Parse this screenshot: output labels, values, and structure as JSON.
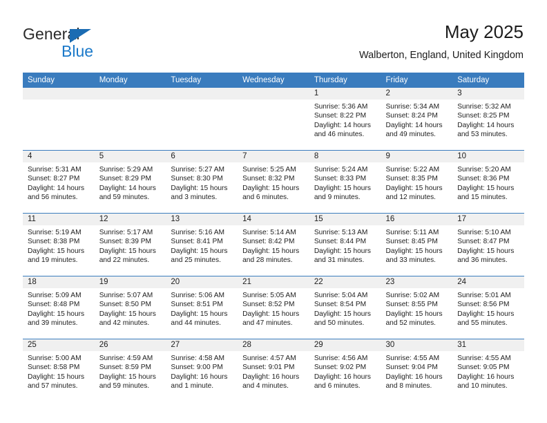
{
  "brand": {
    "name_top": "General",
    "name_bottom": "Blue",
    "triangle_color": "#1b6cb3",
    "blue_text_color": "#1b79c9"
  },
  "header": {
    "title": "May 2025",
    "subtitle": "Walberton, England, United Kingdom"
  },
  "theme": {
    "header_blue": "#3a7cbe",
    "daynum_band": "#f0f0f0",
    "row_divider": "#3a7cbe",
    "text": "#1d1d1d"
  },
  "weekday_headers": [
    "Sunday",
    "Monday",
    "Tuesday",
    "Wednesday",
    "Thursday",
    "Friday",
    "Saturday"
  ],
  "weeks": [
    [
      {
        "empty": true,
        "day": "",
        "sunrise": "",
        "sunset": "",
        "daylight_line1": "",
        "daylight_line2": ""
      },
      {
        "empty": true,
        "day": "",
        "sunrise": "",
        "sunset": "",
        "daylight_line1": "",
        "daylight_line2": ""
      },
      {
        "empty": true,
        "day": "",
        "sunrise": "",
        "sunset": "",
        "daylight_line1": "",
        "daylight_line2": ""
      },
      {
        "empty": true,
        "day": "",
        "sunrise": "",
        "sunset": "",
        "daylight_line1": "",
        "daylight_line2": ""
      },
      {
        "empty": false,
        "day": "1",
        "sunrise": "Sunrise: 5:36 AM",
        "sunset": "Sunset: 8:22 PM",
        "daylight_line1": "Daylight: 14 hours",
        "daylight_line2": "and 46 minutes."
      },
      {
        "empty": false,
        "day": "2",
        "sunrise": "Sunrise: 5:34 AM",
        "sunset": "Sunset: 8:24 PM",
        "daylight_line1": "Daylight: 14 hours",
        "daylight_line2": "and 49 minutes."
      },
      {
        "empty": false,
        "day": "3",
        "sunrise": "Sunrise: 5:32 AM",
        "sunset": "Sunset: 8:25 PM",
        "daylight_line1": "Daylight: 14 hours",
        "daylight_line2": "and 53 minutes."
      }
    ],
    [
      {
        "empty": false,
        "day": "4",
        "sunrise": "Sunrise: 5:31 AM",
        "sunset": "Sunset: 8:27 PM",
        "daylight_line1": "Daylight: 14 hours",
        "daylight_line2": "and 56 minutes."
      },
      {
        "empty": false,
        "day": "5",
        "sunrise": "Sunrise: 5:29 AM",
        "sunset": "Sunset: 8:29 PM",
        "daylight_line1": "Daylight: 14 hours",
        "daylight_line2": "and 59 minutes."
      },
      {
        "empty": false,
        "day": "6",
        "sunrise": "Sunrise: 5:27 AM",
        "sunset": "Sunset: 8:30 PM",
        "daylight_line1": "Daylight: 15 hours",
        "daylight_line2": "and 3 minutes."
      },
      {
        "empty": false,
        "day": "7",
        "sunrise": "Sunrise: 5:25 AM",
        "sunset": "Sunset: 8:32 PM",
        "daylight_line1": "Daylight: 15 hours",
        "daylight_line2": "and 6 minutes."
      },
      {
        "empty": false,
        "day": "8",
        "sunrise": "Sunrise: 5:24 AM",
        "sunset": "Sunset: 8:33 PM",
        "daylight_line1": "Daylight: 15 hours",
        "daylight_line2": "and 9 minutes."
      },
      {
        "empty": false,
        "day": "9",
        "sunrise": "Sunrise: 5:22 AM",
        "sunset": "Sunset: 8:35 PM",
        "daylight_line1": "Daylight: 15 hours",
        "daylight_line2": "and 12 minutes."
      },
      {
        "empty": false,
        "day": "10",
        "sunrise": "Sunrise: 5:20 AM",
        "sunset": "Sunset: 8:36 PM",
        "daylight_line1": "Daylight: 15 hours",
        "daylight_line2": "and 15 minutes."
      }
    ],
    [
      {
        "empty": false,
        "day": "11",
        "sunrise": "Sunrise: 5:19 AM",
        "sunset": "Sunset: 8:38 PM",
        "daylight_line1": "Daylight: 15 hours",
        "daylight_line2": "and 19 minutes."
      },
      {
        "empty": false,
        "day": "12",
        "sunrise": "Sunrise: 5:17 AM",
        "sunset": "Sunset: 8:39 PM",
        "daylight_line1": "Daylight: 15 hours",
        "daylight_line2": "and 22 minutes."
      },
      {
        "empty": false,
        "day": "13",
        "sunrise": "Sunrise: 5:16 AM",
        "sunset": "Sunset: 8:41 PM",
        "daylight_line1": "Daylight: 15 hours",
        "daylight_line2": "and 25 minutes."
      },
      {
        "empty": false,
        "day": "14",
        "sunrise": "Sunrise: 5:14 AM",
        "sunset": "Sunset: 8:42 PM",
        "daylight_line1": "Daylight: 15 hours",
        "daylight_line2": "and 28 minutes."
      },
      {
        "empty": false,
        "day": "15",
        "sunrise": "Sunrise: 5:13 AM",
        "sunset": "Sunset: 8:44 PM",
        "daylight_line1": "Daylight: 15 hours",
        "daylight_line2": "and 31 minutes."
      },
      {
        "empty": false,
        "day": "16",
        "sunrise": "Sunrise: 5:11 AM",
        "sunset": "Sunset: 8:45 PM",
        "daylight_line1": "Daylight: 15 hours",
        "daylight_line2": "and 33 minutes."
      },
      {
        "empty": false,
        "day": "17",
        "sunrise": "Sunrise: 5:10 AM",
        "sunset": "Sunset: 8:47 PM",
        "daylight_line1": "Daylight: 15 hours",
        "daylight_line2": "and 36 minutes."
      }
    ],
    [
      {
        "empty": false,
        "day": "18",
        "sunrise": "Sunrise: 5:09 AM",
        "sunset": "Sunset: 8:48 PM",
        "daylight_line1": "Daylight: 15 hours",
        "daylight_line2": "and 39 minutes."
      },
      {
        "empty": false,
        "day": "19",
        "sunrise": "Sunrise: 5:07 AM",
        "sunset": "Sunset: 8:50 PM",
        "daylight_line1": "Daylight: 15 hours",
        "daylight_line2": "and 42 minutes."
      },
      {
        "empty": false,
        "day": "20",
        "sunrise": "Sunrise: 5:06 AM",
        "sunset": "Sunset: 8:51 PM",
        "daylight_line1": "Daylight: 15 hours",
        "daylight_line2": "and 44 minutes."
      },
      {
        "empty": false,
        "day": "21",
        "sunrise": "Sunrise: 5:05 AM",
        "sunset": "Sunset: 8:52 PM",
        "daylight_line1": "Daylight: 15 hours",
        "daylight_line2": "and 47 minutes."
      },
      {
        "empty": false,
        "day": "22",
        "sunrise": "Sunrise: 5:04 AM",
        "sunset": "Sunset: 8:54 PM",
        "daylight_line1": "Daylight: 15 hours",
        "daylight_line2": "and 50 minutes."
      },
      {
        "empty": false,
        "day": "23",
        "sunrise": "Sunrise: 5:02 AM",
        "sunset": "Sunset: 8:55 PM",
        "daylight_line1": "Daylight: 15 hours",
        "daylight_line2": "and 52 minutes."
      },
      {
        "empty": false,
        "day": "24",
        "sunrise": "Sunrise: 5:01 AM",
        "sunset": "Sunset: 8:56 PM",
        "daylight_line1": "Daylight: 15 hours",
        "daylight_line2": "and 55 minutes."
      }
    ],
    [
      {
        "empty": false,
        "day": "25",
        "sunrise": "Sunrise: 5:00 AM",
        "sunset": "Sunset: 8:58 PM",
        "daylight_line1": "Daylight: 15 hours",
        "daylight_line2": "and 57 minutes."
      },
      {
        "empty": false,
        "day": "26",
        "sunrise": "Sunrise: 4:59 AM",
        "sunset": "Sunset: 8:59 PM",
        "daylight_line1": "Daylight: 15 hours",
        "daylight_line2": "and 59 minutes."
      },
      {
        "empty": false,
        "day": "27",
        "sunrise": "Sunrise: 4:58 AM",
        "sunset": "Sunset: 9:00 PM",
        "daylight_line1": "Daylight: 16 hours",
        "daylight_line2": "and 1 minute."
      },
      {
        "empty": false,
        "day": "28",
        "sunrise": "Sunrise: 4:57 AM",
        "sunset": "Sunset: 9:01 PM",
        "daylight_line1": "Daylight: 16 hours",
        "daylight_line2": "and 4 minutes."
      },
      {
        "empty": false,
        "day": "29",
        "sunrise": "Sunrise: 4:56 AM",
        "sunset": "Sunset: 9:02 PM",
        "daylight_line1": "Daylight: 16 hours",
        "daylight_line2": "and 6 minutes."
      },
      {
        "empty": false,
        "day": "30",
        "sunrise": "Sunrise: 4:55 AM",
        "sunset": "Sunset: 9:04 PM",
        "daylight_line1": "Daylight: 16 hours",
        "daylight_line2": "and 8 minutes."
      },
      {
        "empty": false,
        "day": "31",
        "sunrise": "Sunrise: 4:55 AM",
        "sunset": "Sunset: 9:05 PM",
        "daylight_line1": "Daylight: 16 hours",
        "daylight_line2": "and 10 minutes."
      }
    ]
  ]
}
